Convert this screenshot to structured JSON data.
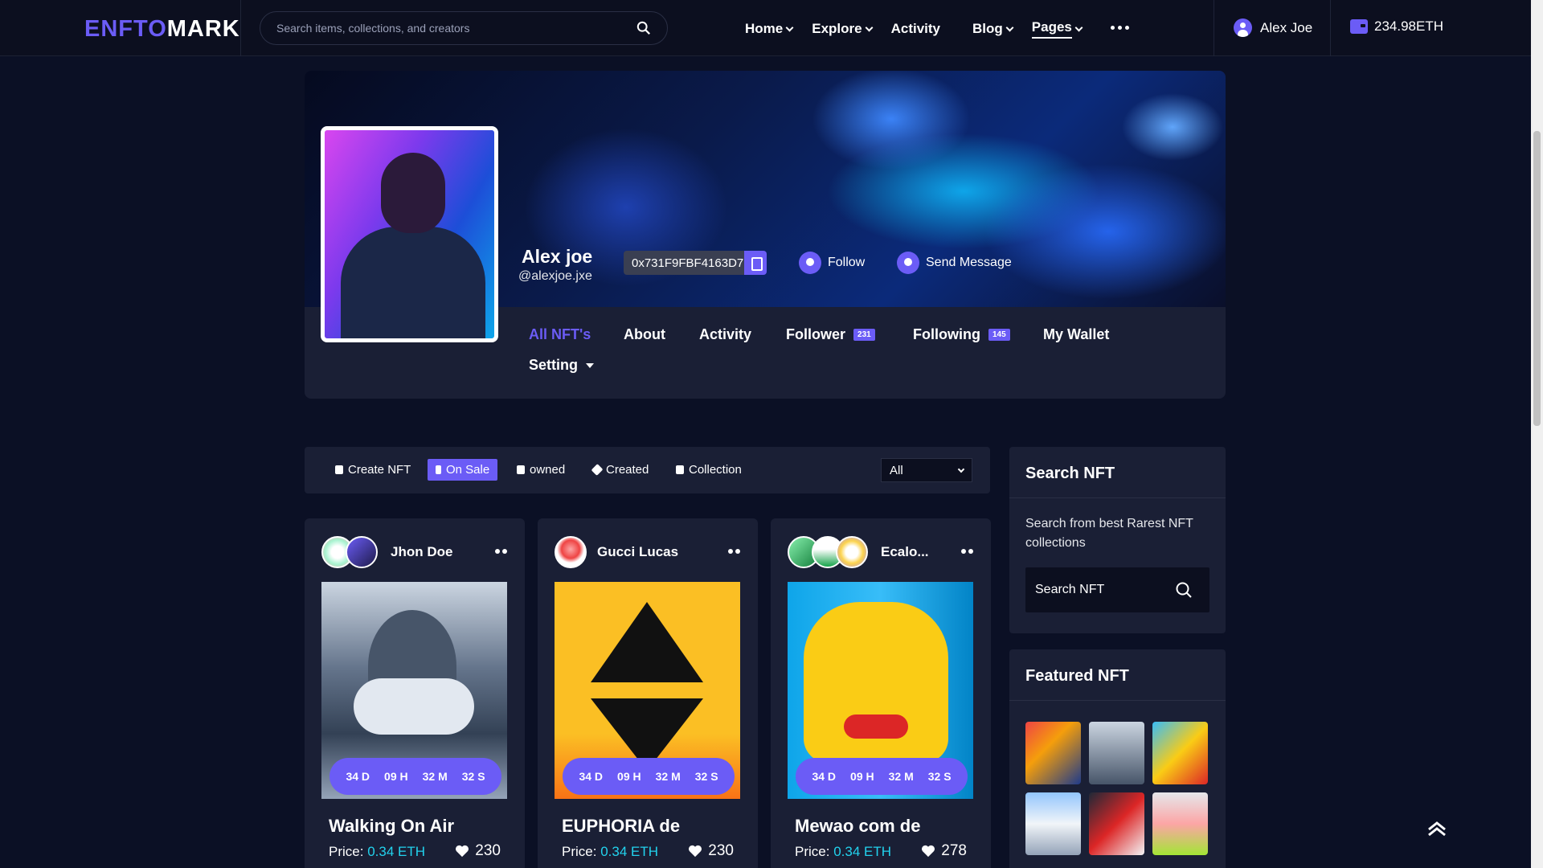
{
  "header": {
    "logo_part1": "ENFTO",
    "logo_part2": "MARK",
    "search_placeholder": "Search items, collections, and creators",
    "nav": [
      "Home",
      "Explore",
      "Activity",
      "Blog",
      "Pages"
    ],
    "user_name": "Alex Joe",
    "wallet_balance": "234.98ETH"
  },
  "profile": {
    "name": "Alex joe",
    "handle": "@alexjoe.jxe",
    "address": "0x731F9FBF4163D7",
    "follow_label": "Follow",
    "message_label": "Send Message",
    "tabs": {
      "all_nfts": "All NFT's",
      "about": "About",
      "activity": "Activity",
      "follower": "Follower",
      "follower_count": "231",
      "following": "Following",
      "following_count": "145",
      "wallet": "My Wallet",
      "setting": "Setting"
    }
  },
  "filters": {
    "create": "Create NFT",
    "on_sale": "On Sale",
    "owned": "owned",
    "created": "Created",
    "collection": "Collection",
    "select_value": "All"
  },
  "cards": [
    {
      "owner": "Jhon Doe",
      "title": "Walking On Air",
      "price_label": "Price:",
      "price": "0.34 ETH",
      "likes": "230",
      "d": "34 D",
      "h": "09 H",
      "m": "32 M",
      "s": "32 S"
    },
    {
      "owner": "Gucci Lucas",
      "title": "EUPHORIA de",
      "price_label": "Price:",
      "price": "0.34 ETH",
      "likes": "230",
      "d": "34 D",
      "h": "09 H",
      "m": "32 M",
      "s": "32 S"
    },
    {
      "owner": "Ecalo...",
      "title": "Mewao com de",
      "price_label": "Price:",
      "price": "0.34 ETH",
      "likes": "278",
      "d": "34 D",
      "h": "09 H",
      "m": "32 M",
      "s": "32 S"
    }
  ],
  "sidebar": {
    "search_title": "Search NFT",
    "search_desc": "Search from best Rarest NFT collections",
    "search_placeholder": "Search NFT",
    "featured_title": "Featured NFT"
  },
  "colors": {
    "accent": "#6b5cf6",
    "price": "#22d3ee",
    "card_bg": "#1a1f35",
    "page_bg": "#0b1025"
  }
}
